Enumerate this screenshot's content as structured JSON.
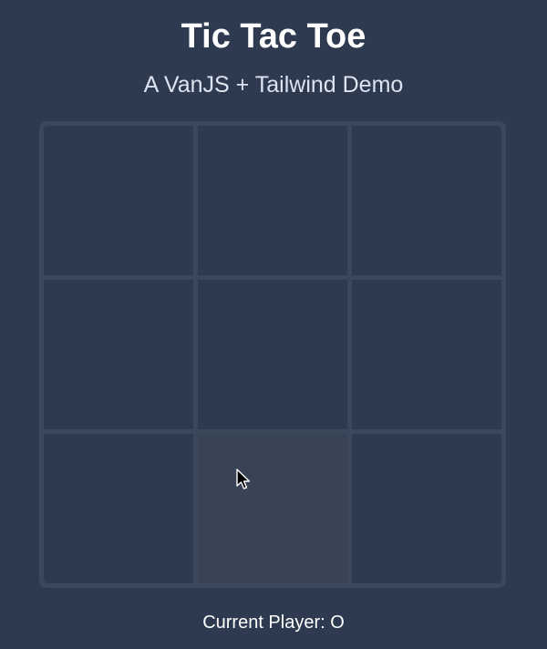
{
  "header": {
    "title": "Tic Tac Toe",
    "subtitle": "A VanJS + Tailwind Demo"
  },
  "board": {
    "cells": [
      [
        "",
        "",
        ""
      ],
      [
        "",
        "",
        ""
      ],
      [
        "",
        "",
        ""
      ]
    ],
    "hovered_cell": [
      2,
      1
    ]
  },
  "status": {
    "text": "Current Player: O"
  },
  "colors": {
    "background": "#2e3a4f",
    "board_frame": "#3b475b",
    "cell_hover": "#384356",
    "text": "#ffffff",
    "subtitle_text": "#dbe4f0"
  },
  "icons": {
    "cursor": "mouse-pointer-icon"
  }
}
